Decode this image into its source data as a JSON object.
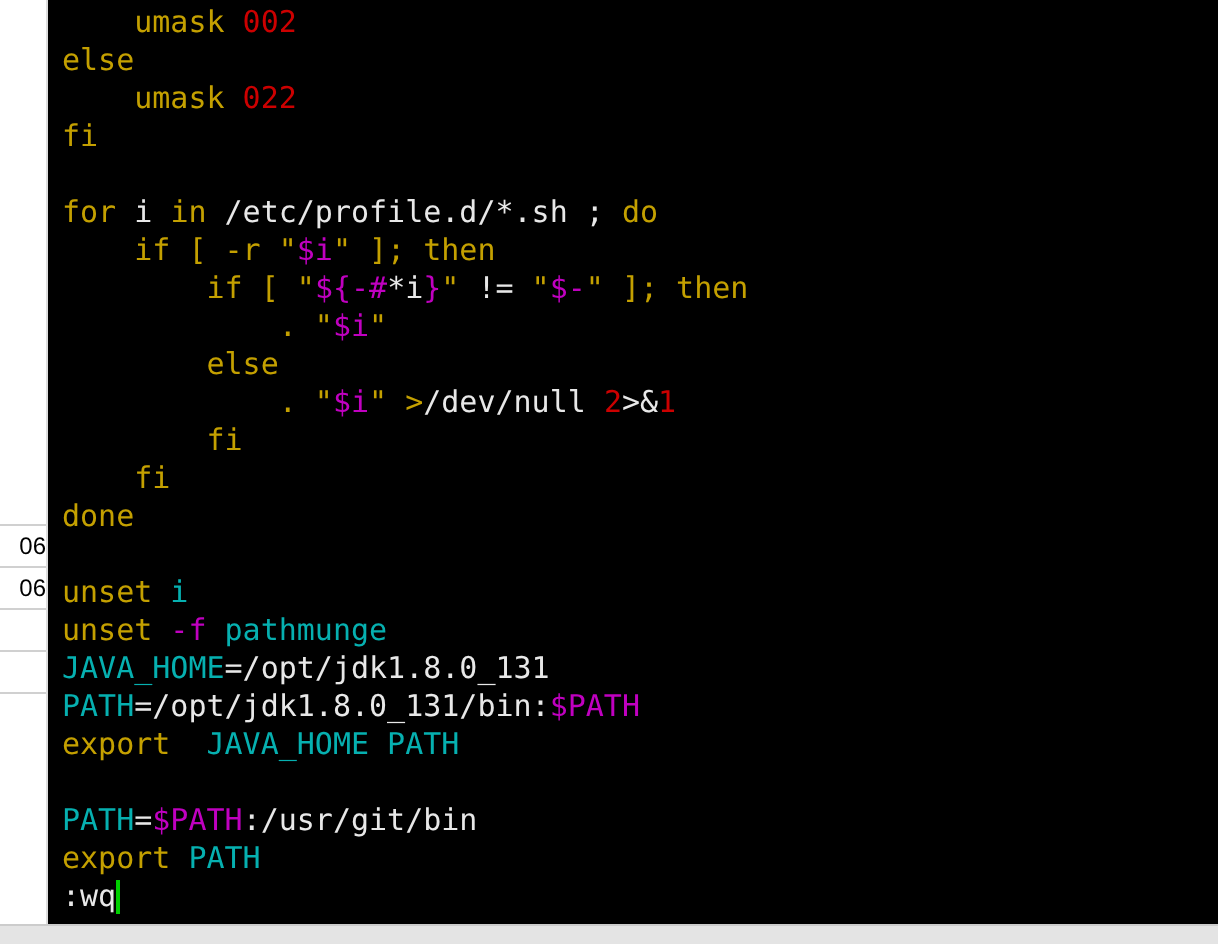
{
  "side_panel": {
    "cells": [
      "06",
      "06"
    ]
  },
  "editor": {
    "lines": [
      {
        "kind": "code",
        "tokens": [
          {
            "text": "    umask",
            "kind": "kw"
          },
          {
            "text": " 002",
            "kind": "num"
          }
        ]
      },
      {
        "kind": "code",
        "tokens": [
          {
            "text": "else",
            "kind": "kw"
          }
        ]
      },
      {
        "kind": "code",
        "tokens": [
          {
            "text": "    umask",
            "kind": "kw"
          },
          {
            "text": " 022",
            "kind": "num"
          }
        ]
      },
      {
        "kind": "code",
        "tokens": [
          {
            "text": "fi",
            "kind": "kw"
          }
        ]
      },
      {
        "kind": "blank"
      },
      {
        "kind": "code",
        "tokens": [
          {
            "text": "for",
            "kind": "kw"
          },
          {
            "text": " i ",
            "kind": "plain"
          },
          {
            "text": "in",
            "kind": "kw"
          },
          {
            "text": " /etc/profile.d/*.sh ; ",
            "kind": "plain"
          },
          {
            "text": "do",
            "kind": "kw"
          }
        ]
      },
      {
        "kind": "code",
        "tokens": [
          {
            "text": "    if [ -r \"",
            "kind": "kw"
          },
          {
            "text": "$i",
            "kind": "var"
          },
          {
            "text": "\" ]; then",
            "kind": "kw"
          }
        ]
      },
      {
        "kind": "code",
        "tokens": [
          {
            "text": "        if [ \"",
            "kind": "kw"
          },
          {
            "text": "${-#",
            "kind": "var"
          },
          {
            "text": "*i",
            "kind": "plain"
          },
          {
            "text": "}",
            "kind": "var"
          },
          {
            "text": "\" ",
            "kind": "kw"
          },
          {
            "text": "!=",
            "kind": "plain"
          },
          {
            "text": " \"",
            "kind": "kw"
          },
          {
            "text": "$-",
            "kind": "var"
          },
          {
            "text": "\" ]; then",
            "kind": "kw"
          }
        ]
      },
      {
        "kind": "code",
        "tokens": [
          {
            "text": "            . \"",
            "kind": "kw"
          },
          {
            "text": "$i",
            "kind": "var"
          },
          {
            "text": "\"",
            "kind": "kw"
          }
        ]
      },
      {
        "kind": "code",
        "tokens": [
          {
            "text": "        else",
            "kind": "kw"
          }
        ]
      },
      {
        "kind": "code",
        "tokens": [
          {
            "text": "            . \"",
            "kind": "kw"
          },
          {
            "text": "$i",
            "kind": "var"
          },
          {
            "text": "\" >",
            "kind": "kw"
          },
          {
            "text": "/dev/null ",
            "kind": "plain"
          },
          {
            "text": "2",
            "kind": "num"
          },
          {
            "text": ">&",
            "kind": "plain"
          },
          {
            "text": "1",
            "kind": "num"
          }
        ]
      },
      {
        "kind": "code",
        "tokens": [
          {
            "text": "        fi",
            "kind": "kw"
          }
        ]
      },
      {
        "kind": "code",
        "tokens": [
          {
            "text": "    fi",
            "kind": "kw"
          }
        ]
      },
      {
        "kind": "code",
        "tokens": [
          {
            "text": "done",
            "kind": "kw"
          }
        ]
      },
      {
        "kind": "blank"
      },
      {
        "kind": "code",
        "tokens": [
          {
            "text": "unset",
            "kind": "kw"
          },
          {
            "text": " i",
            "kind": "id"
          }
        ]
      },
      {
        "kind": "code",
        "tokens": [
          {
            "text": "unset",
            "kind": "kw"
          },
          {
            "text": " -f",
            "kind": "var"
          },
          {
            "text": " pathmunge",
            "kind": "id"
          }
        ]
      },
      {
        "kind": "code",
        "tokens": [
          {
            "text": "JAVA_HOME",
            "kind": "id"
          },
          {
            "text": "=/opt/jdk1.8.0_131",
            "kind": "plain"
          }
        ]
      },
      {
        "kind": "code",
        "tokens": [
          {
            "text": "PATH",
            "kind": "id"
          },
          {
            "text": "=/opt/jdk1.8.0_131/bin:",
            "kind": "plain"
          },
          {
            "text": "$PATH",
            "kind": "var"
          }
        ]
      },
      {
        "kind": "code",
        "tokens": [
          {
            "text": "export",
            "kind": "kw"
          },
          {
            "text": "  JAVA_HOME PATH",
            "kind": "id"
          }
        ]
      },
      {
        "kind": "blank"
      },
      {
        "kind": "code",
        "tokens": [
          {
            "text": "PATH",
            "kind": "id"
          },
          {
            "text": "=",
            "kind": "plain"
          },
          {
            "text": "$PATH",
            "kind": "var"
          },
          {
            "text": ":/usr/git/bin",
            "kind": "plain"
          }
        ]
      },
      {
        "kind": "code",
        "tokens": [
          {
            "text": "export",
            "kind": "kw"
          },
          {
            "text": " PATH",
            "kind": "id"
          }
        ]
      },
      {
        "kind": "command",
        "tokens": [
          {
            "text": ":wq",
            "kind": "plain"
          }
        ]
      }
    ]
  }
}
